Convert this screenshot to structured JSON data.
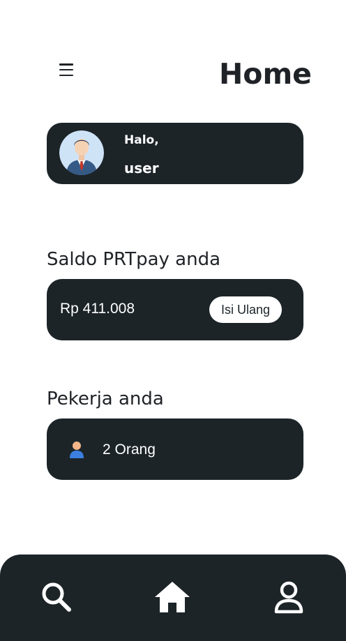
{
  "header": {
    "title": "Home",
    "menu_icon": "menu-icon"
  },
  "user_card": {
    "greeting": "Halo,",
    "username": "user",
    "avatar_icon": "avatar-icon"
  },
  "balance": {
    "label": "Saldo PRTpay anda",
    "amount": "Rp 411.008",
    "topup_label": "Isi Ulang"
  },
  "workers": {
    "label": "Pekerja anda",
    "count": "2 Orang",
    "icon": "person-icon"
  },
  "bottom_nav": {
    "items": [
      {
        "icon": "search-icon"
      },
      {
        "icon": "home-icon"
      },
      {
        "icon": "profile-icon"
      }
    ]
  },
  "colors": {
    "card_background": "#1c2428",
    "text_dark": "#1f2226",
    "text_light": "#ffffff",
    "worker_icon_blue": "#3b7fe0",
    "worker_icon_skin": "#f4b48a"
  }
}
